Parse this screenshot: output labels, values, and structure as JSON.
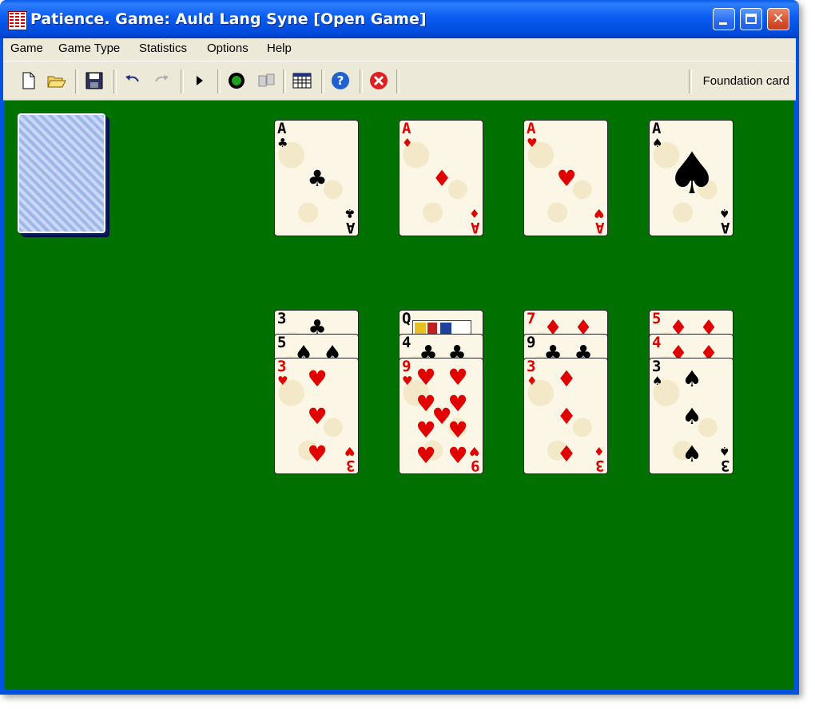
{
  "window": {
    "title": "Patience. Game: Auld Lang Syne  [Open Game]"
  },
  "caption_buttons": {
    "minimize": "_",
    "maximize": "□",
    "close": "✕"
  },
  "menu": [
    "Game",
    "Game Type",
    "Statistics",
    "Options",
    "Help"
  ],
  "toolbar": {
    "buttons": [
      "new-game",
      "open-game",
      "save-game",
      "undo",
      "redo",
      "play",
      "record",
      "deal",
      "statistics-table",
      "help",
      "exit"
    ],
    "status_text": "Foundation card"
  },
  "colors": {
    "table_green": "#007000",
    "red_suit": "#e00000",
    "black_suit": "#000000",
    "card_face": "#fbf6e6"
  },
  "foundations": [
    {
      "rank": "A",
      "suit": "♣",
      "color": "black"
    },
    {
      "rank": "A",
      "suit": "♦",
      "color": "red"
    },
    {
      "rank": "A",
      "suit": "♥",
      "color": "red"
    },
    {
      "rank": "A",
      "suit": "♠",
      "color": "black"
    }
  ],
  "tableau": [
    {
      "cards": [
        {
          "rank": "3",
          "suit": "♣",
          "color": "black"
        },
        {
          "rank": "5",
          "suit": "♠",
          "color": "black"
        },
        {
          "rank": "3",
          "suit": "♥",
          "color": "red"
        }
      ]
    },
    {
      "cards": [
        {
          "rank": "Q",
          "suit": "♣",
          "color": "black"
        },
        {
          "rank": "4",
          "suit": "♣",
          "color": "black"
        },
        {
          "rank": "9",
          "suit": "♥",
          "color": "red"
        }
      ]
    },
    {
      "cards": [
        {
          "rank": "7",
          "suit": "♦",
          "color": "red"
        },
        {
          "rank": "9",
          "suit": "♣",
          "color": "black"
        },
        {
          "rank": "3",
          "suit": "♦",
          "color": "red"
        }
      ]
    },
    {
      "cards": [
        {
          "rank": "5",
          "suit": "♦",
          "color": "red"
        },
        {
          "rank": "4",
          "suit": "♦",
          "color": "red"
        },
        {
          "rank": "3",
          "suit": "♠",
          "color": "black"
        }
      ]
    }
  ]
}
